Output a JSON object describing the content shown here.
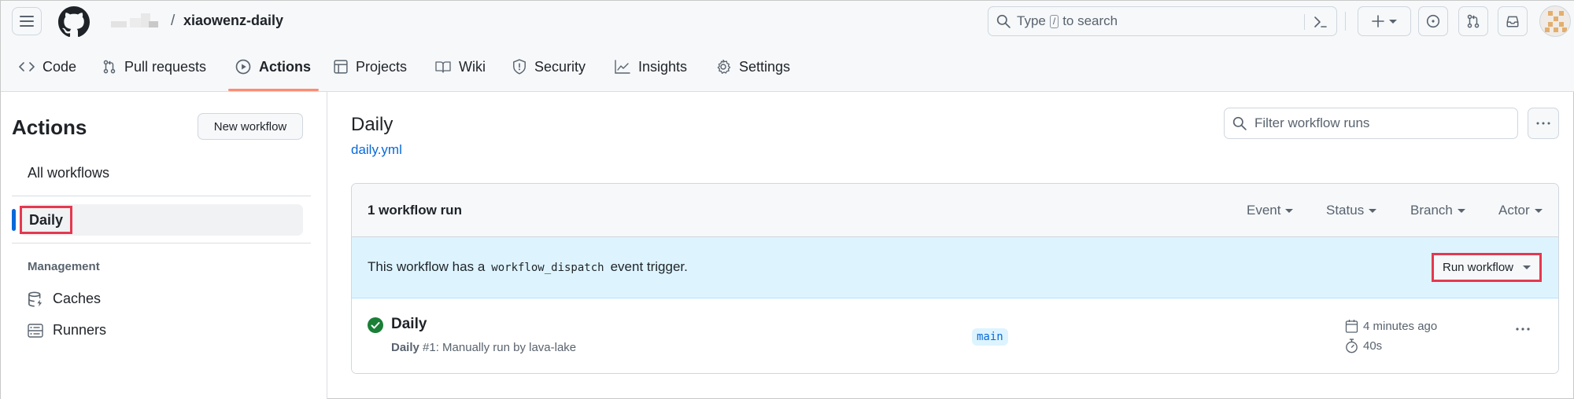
{
  "header": {
    "repo_separator": "/",
    "repo_name": "xiaowenz-daily",
    "search": {
      "prefix": "Type",
      "key": "/",
      "suffix": "to search"
    },
    "icons": [
      "hamburger-icon",
      "github-logo",
      "search-icon",
      "command-palette-icon",
      "plus-icon",
      "issues-icon",
      "pull-requests-icon",
      "inbox-icon",
      "avatar"
    ]
  },
  "repo_nav": {
    "tabs": [
      {
        "label": "Code",
        "icon": "code-icon"
      },
      {
        "label": "Pull requests",
        "icon": "pull-request-icon"
      },
      {
        "label": "Actions",
        "icon": "play-icon",
        "active": true
      },
      {
        "label": "Projects",
        "icon": "table-icon"
      },
      {
        "label": "Wiki",
        "icon": "book-icon"
      },
      {
        "label": "Security",
        "icon": "shield-icon"
      },
      {
        "label": "Insights",
        "icon": "graph-icon"
      },
      {
        "label": "Settings",
        "icon": "gear-icon"
      }
    ]
  },
  "sidebar": {
    "title": "Actions",
    "new_workflow_label": "New workflow",
    "all_workflows_label": "All workflows",
    "selected_workflow": "Daily",
    "management_heading": "Management",
    "management_items": [
      {
        "label": "Caches",
        "icon": "database-icon"
      },
      {
        "label": "Runners",
        "icon": "server-icon"
      }
    ]
  },
  "main": {
    "workflow_title": "Daily",
    "workflow_file": "daily.yml",
    "filter_placeholder": "Filter workflow runs",
    "runs_count": "1 workflow run",
    "filters": [
      "Event",
      "Status",
      "Branch",
      "Actor"
    ],
    "dispatch": {
      "text_before": "This workflow has a",
      "code": "workflow_dispatch",
      "text_after": "event trigger.",
      "run_button_label": "Run workflow"
    },
    "runs": [
      {
        "title": "Daily",
        "status": "success",
        "workflow_name": "Daily",
        "run_number": "#1",
        "description": ": Manually run by lava-lake",
        "branch": "main",
        "time_ago": "4 minutes ago",
        "duration": "40s"
      }
    ]
  },
  "colors": {
    "accent_blue": "#0969da",
    "success_green": "#1a7f37",
    "active_tab_underline": "#fd8c73",
    "highlight_red": "#e5384f",
    "banner_bg": "#ddf4ff"
  }
}
